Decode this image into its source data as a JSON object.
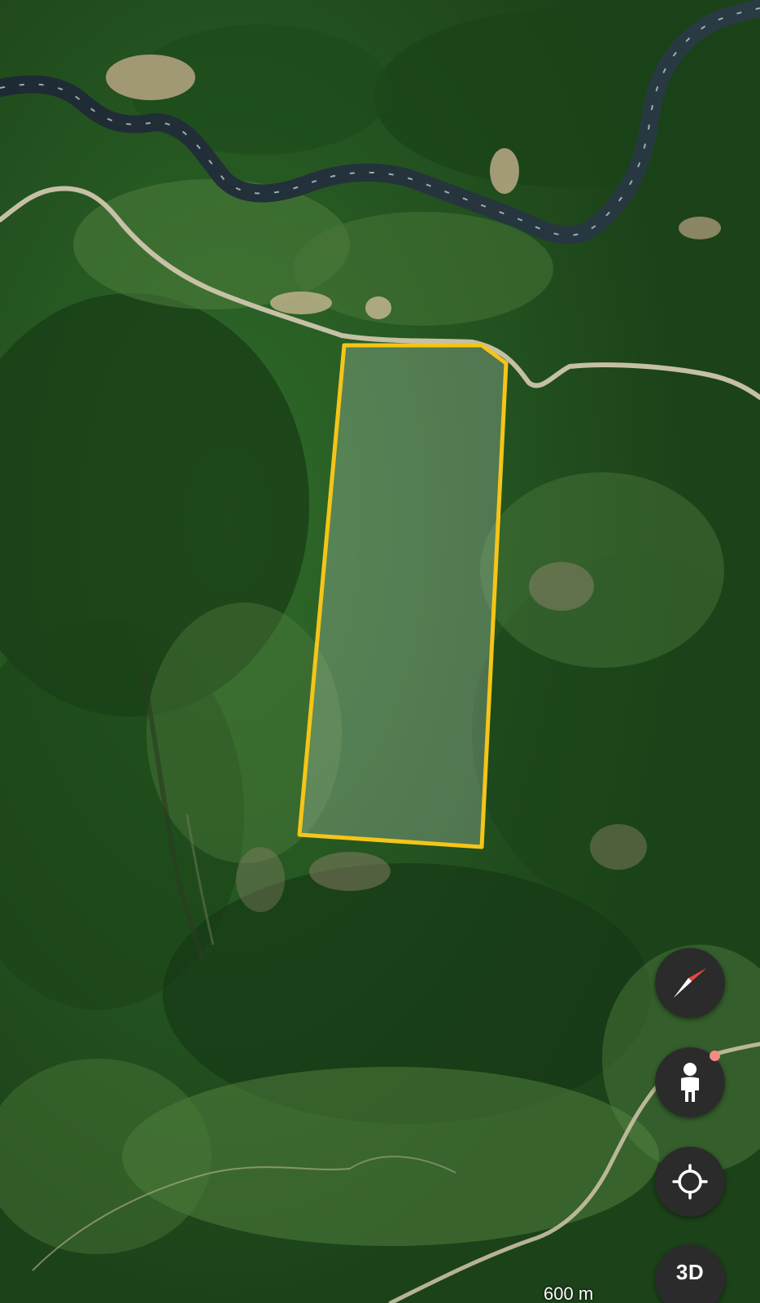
{
  "map": {
    "view": "satellite",
    "features": [
      "river",
      "mountain-road",
      "forest-slopes",
      "valley-road"
    ],
    "highlight_polygon": {
      "shape": "quadrilateral",
      "stroke_color": "#f5c518",
      "fill_color": "rgba(200,220,210,0.28)"
    }
  },
  "controls": {
    "compass": {
      "icon": "compass-needle-icon",
      "needle_color": "#e8453c"
    },
    "street_view": {
      "icon": "pegman-icon",
      "has_notification": true,
      "dot_color": "#f28b82"
    },
    "my_location": {
      "icon": "crosshair-icon"
    },
    "layers_3d": {
      "label": "3D"
    }
  },
  "scale_bar": {
    "label": "600 m"
  }
}
